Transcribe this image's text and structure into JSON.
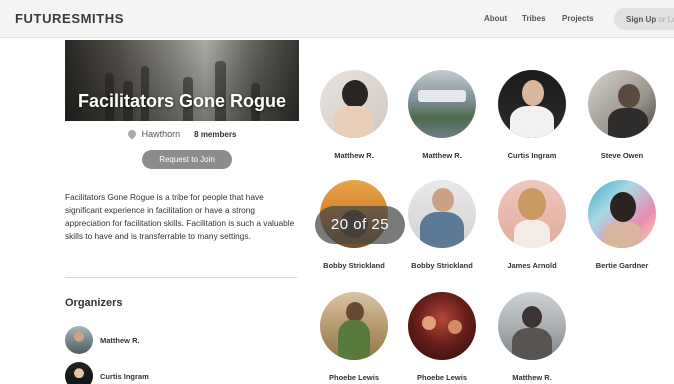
{
  "header": {
    "logo": "FUTURESMITHS",
    "nav": [
      "About",
      "Tribes",
      "Projects"
    ],
    "signup_label": "Sign Up",
    "signup_or": " or Lo"
  },
  "tribe": {
    "title": "Facilitators Gone Rogue",
    "location": "Hawthorn",
    "members": "8 members",
    "join_label": "Request to Join",
    "description": "Facilitators Gone Rogue is a tribe for people that have significant experience in facilitation or have a strong appreciation for facilitation skills. Facilitation is such a valuable skills to have and is transferrable to many settings."
  },
  "organizers": {
    "title": "Organizers",
    "items": [
      {
        "name": "Matthew R."
      },
      {
        "name": "Curtis Ingram"
      }
    ]
  },
  "members_grid": [
    {
      "name": "Matthew R."
    },
    {
      "name": "Matthew R."
    },
    {
      "name": "Curtis Ingram"
    },
    {
      "name": "Steve Owen"
    },
    {
      "name": "Bobby Strickland"
    },
    {
      "name": "Bobby Strickland"
    },
    {
      "name": "James Arnold"
    },
    {
      "name": "Bertie Gardner"
    },
    {
      "name": "Phoebe Lewis"
    },
    {
      "name": "Phoebe Lewis"
    },
    {
      "name": "Matthew R."
    }
  ],
  "gallery": {
    "counter": "20 of 25"
  },
  "colors": {
    "header_bg": "#f4f4f4",
    "button_gray": "#8c8c8c",
    "text_dark": "#333333"
  },
  "icons": {
    "location": "map-pin-icon"
  }
}
